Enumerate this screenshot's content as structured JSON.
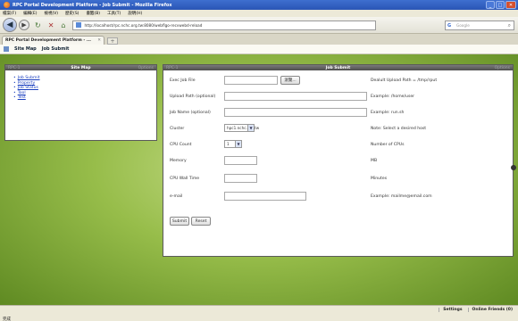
{
  "window": {
    "title": "RPC Portal Development Platform - Job Submit - Mozilla Firefox",
    "controls": [
      "_",
      "□",
      "✕"
    ]
  },
  "menubar": [
    "檔案(F)",
    "編輯(E)",
    "檢視(V)",
    "歷史(S)",
    "書籤(B)",
    "工具(T)",
    "說明(H)"
  ],
  "navbar": {
    "url": "http://localhost/rpc.nchc.org.tw:8080/webflgo-recvwebd-reload",
    "search_placeholder": "Google"
  },
  "tab": {
    "label": "RPC Portal Development Platform - ...",
    "new_tab": "+"
  },
  "breadcrumb": {
    "site_map": "Site Map",
    "job_submit": "Job Submit"
  },
  "sitemap": {
    "title": "Site Map",
    "link": "RPC-1",
    "options": "Options",
    "items": [
      "Job Submit",
      "Property",
      "Job Status",
      "Tool",
      "Test"
    ]
  },
  "jobsubmit": {
    "title": "Job Submit",
    "link": "RPC-1",
    "options": "Options",
    "fields": [
      {
        "label": "Exec Job File",
        "note": "Dealult Upload Path = /tmp/rput"
      },
      {
        "label": "Upload Path (optional)",
        "note": "Example: /home/user"
      },
      {
        "label": "Job Name (optional)",
        "note": "Example: run.sh"
      },
      {
        "label": "Cluster",
        "note": "Note: Select a desired host"
      },
      {
        "label": "CPU Count",
        "note": "Number of CPUs"
      },
      {
        "label": "Memory",
        "note": "MB"
      },
      {
        "label": "CPU Wall Time",
        "note": "Minutes"
      },
      {
        "label": "e-mail",
        "note": "Example: mailme@email.com"
      }
    ],
    "browse_label": "瀏覽...",
    "cluster_value": "hpc1.nchc.org.tw",
    "cpu_count_value": "1",
    "submit_label": "Submit",
    "reset_label": "Reset"
  },
  "statusbar": {
    "status": "完成",
    "settings": "Settings",
    "online_friends": "Online Friends (0)"
  }
}
